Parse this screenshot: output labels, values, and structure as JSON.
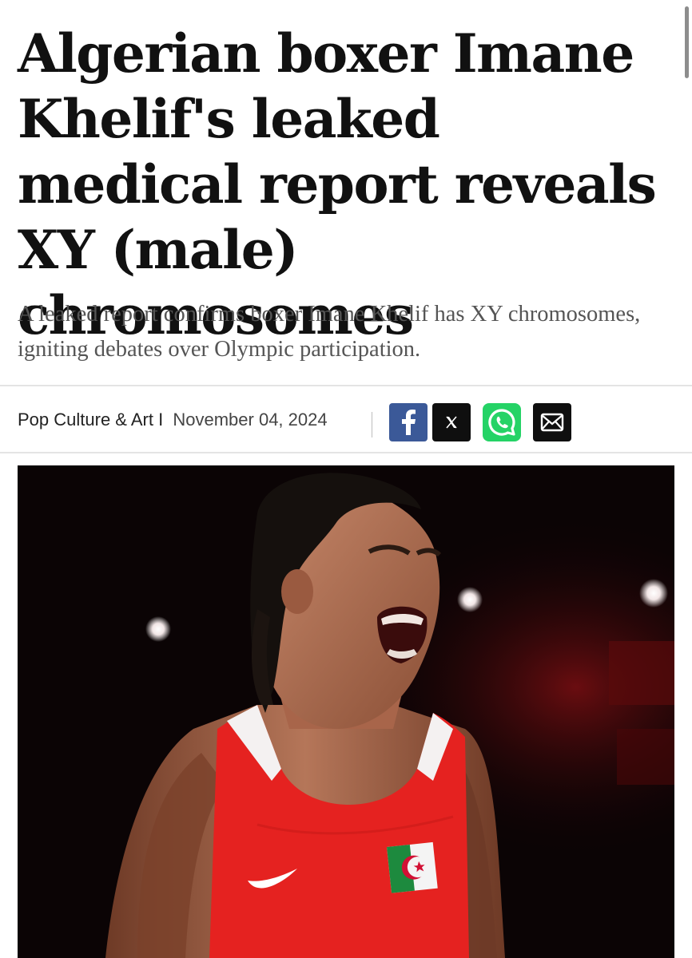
{
  "article": {
    "headline": "Algerian boxer Imane Khelif's leaked medical report reveals XY (male) chromosomes",
    "subtitle": "A leaked report confirms boxer Imane Khelif has XY chromosomes, igniting debates over Olympic participation.",
    "category": "Pop Culture & Art",
    "category_separator": "I",
    "date": "November 04, 2024"
  },
  "share": {
    "facebook_icon": "facebook-icon",
    "x_icon": "x-icon",
    "whatsapp_icon": "whatsapp-icon",
    "email_icon": "email-icon"
  },
  "colors": {
    "facebook": "#3b5998",
    "x": "#0f0f0f",
    "whatsapp": "#25d366",
    "email": "#0f0f0f",
    "headline": "#111111",
    "subtitle": "#555555"
  },
  "image": {
    "subject": "boxer in red Algeria singlet shouting against dark arena background"
  }
}
